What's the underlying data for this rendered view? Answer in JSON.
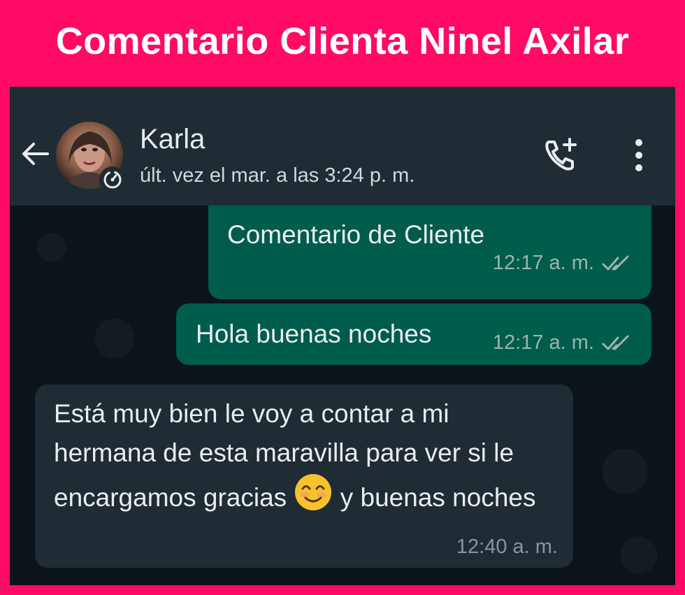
{
  "banner": {
    "title": "Comentario Clienta Ninel Axilar"
  },
  "header": {
    "contact_name": "Karla",
    "last_seen": "últ. vez el mar. a las 3:24 p. m.",
    "icons": [
      "back-arrow-icon",
      "disappearing-timer-icon",
      "add-call-icon",
      "more-options-icon"
    ]
  },
  "messages": [
    {
      "direction": "outgoing",
      "text": "Comentario de Cliente",
      "time": "12:17 a. m.",
      "status": "read"
    },
    {
      "direction": "outgoing",
      "text": "Hola buenas noches",
      "time": "12:17 a. m.",
      "status": "read"
    },
    {
      "direction": "incoming",
      "text_before_emoji": "Está muy bien le voy a  contar a mi hermana de esta maravilla para ver si le encargamos gracias ",
      "emoji": "😊",
      "text_after_emoji": " y buenas noches",
      "time": "12:40 a. m."
    }
  ],
  "colors": {
    "frame": "#ff0a64",
    "header_bg": "#202c33",
    "chat_bg": "#0b141a",
    "outgoing_bubble": "#005c4b",
    "incoming_bubble": "#202c33"
  }
}
